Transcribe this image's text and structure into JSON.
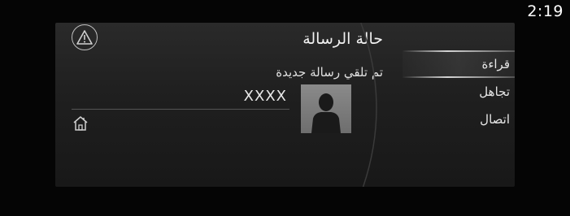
{
  "status_bar": {
    "time": "2:19"
  },
  "screen": {
    "title": "حالة الرسالة",
    "message_status": "تم تلقي رسالة جديدة",
    "sender": "XXXX"
  },
  "menu": {
    "items": [
      {
        "label": "قراءة",
        "selected": true
      },
      {
        "label": "تجاهل",
        "selected": false
      },
      {
        "label": "اتصال",
        "selected": false
      }
    ]
  },
  "icons": {
    "warning": "warning-icon",
    "home": "home-icon",
    "contact": "contact-avatar"
  }
}
